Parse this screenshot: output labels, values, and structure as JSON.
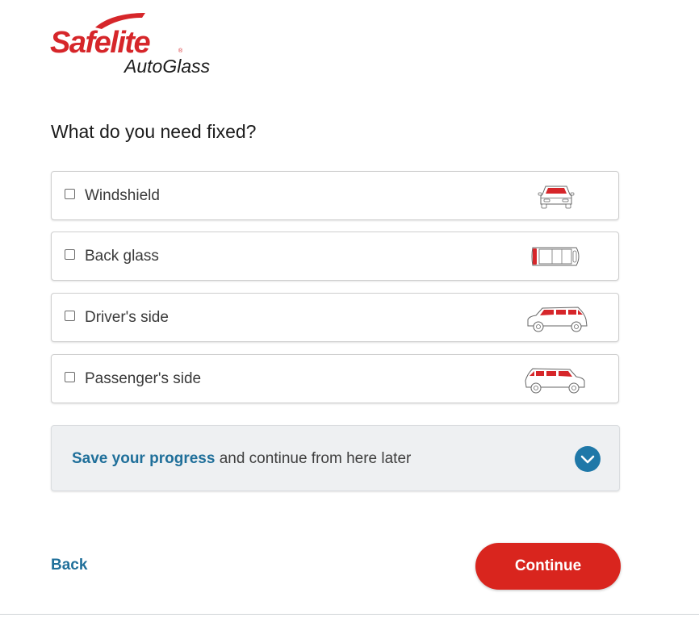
{
  "brand": {
    "name": "Safelite",
    "registered": "®",
    "sub": "AutoGlass",
    "color": "#d6262a"
  },
  "question": "What do you need fixed?",
  "options": [
    {
      "label": "Windshield",
      "checked": false,
      "icon": "windshield-car-icon"
    },
    {
      "label": "Back glass",
      "checked": false,
      "icon": "back-glass-car-icon"
    },
    {
      "label": "Driver's side",
      "checked": false,
      "icon": "driver-side-car-icon"
    },
    {
      "label": "Passenger's side",
      "checked": false,
      "icon": "passenger-side-car-icon"
    }
  ],
  "save": {
    "link_text": "Save your progress",
    "rest_text": " and continue from here later",
    "icon": "chevron-down-icon"
  },
  "nav": {
    "back_label": "Back",
    "continue_label": "Continue"
  },
  "colors": {
    "accent_red": "#d9251e",
    "link_blue": "#1f6f9a",
    "chevron_blue": "#1f78a8",
    "panel_bg": "#eef0f2"
  }
}
